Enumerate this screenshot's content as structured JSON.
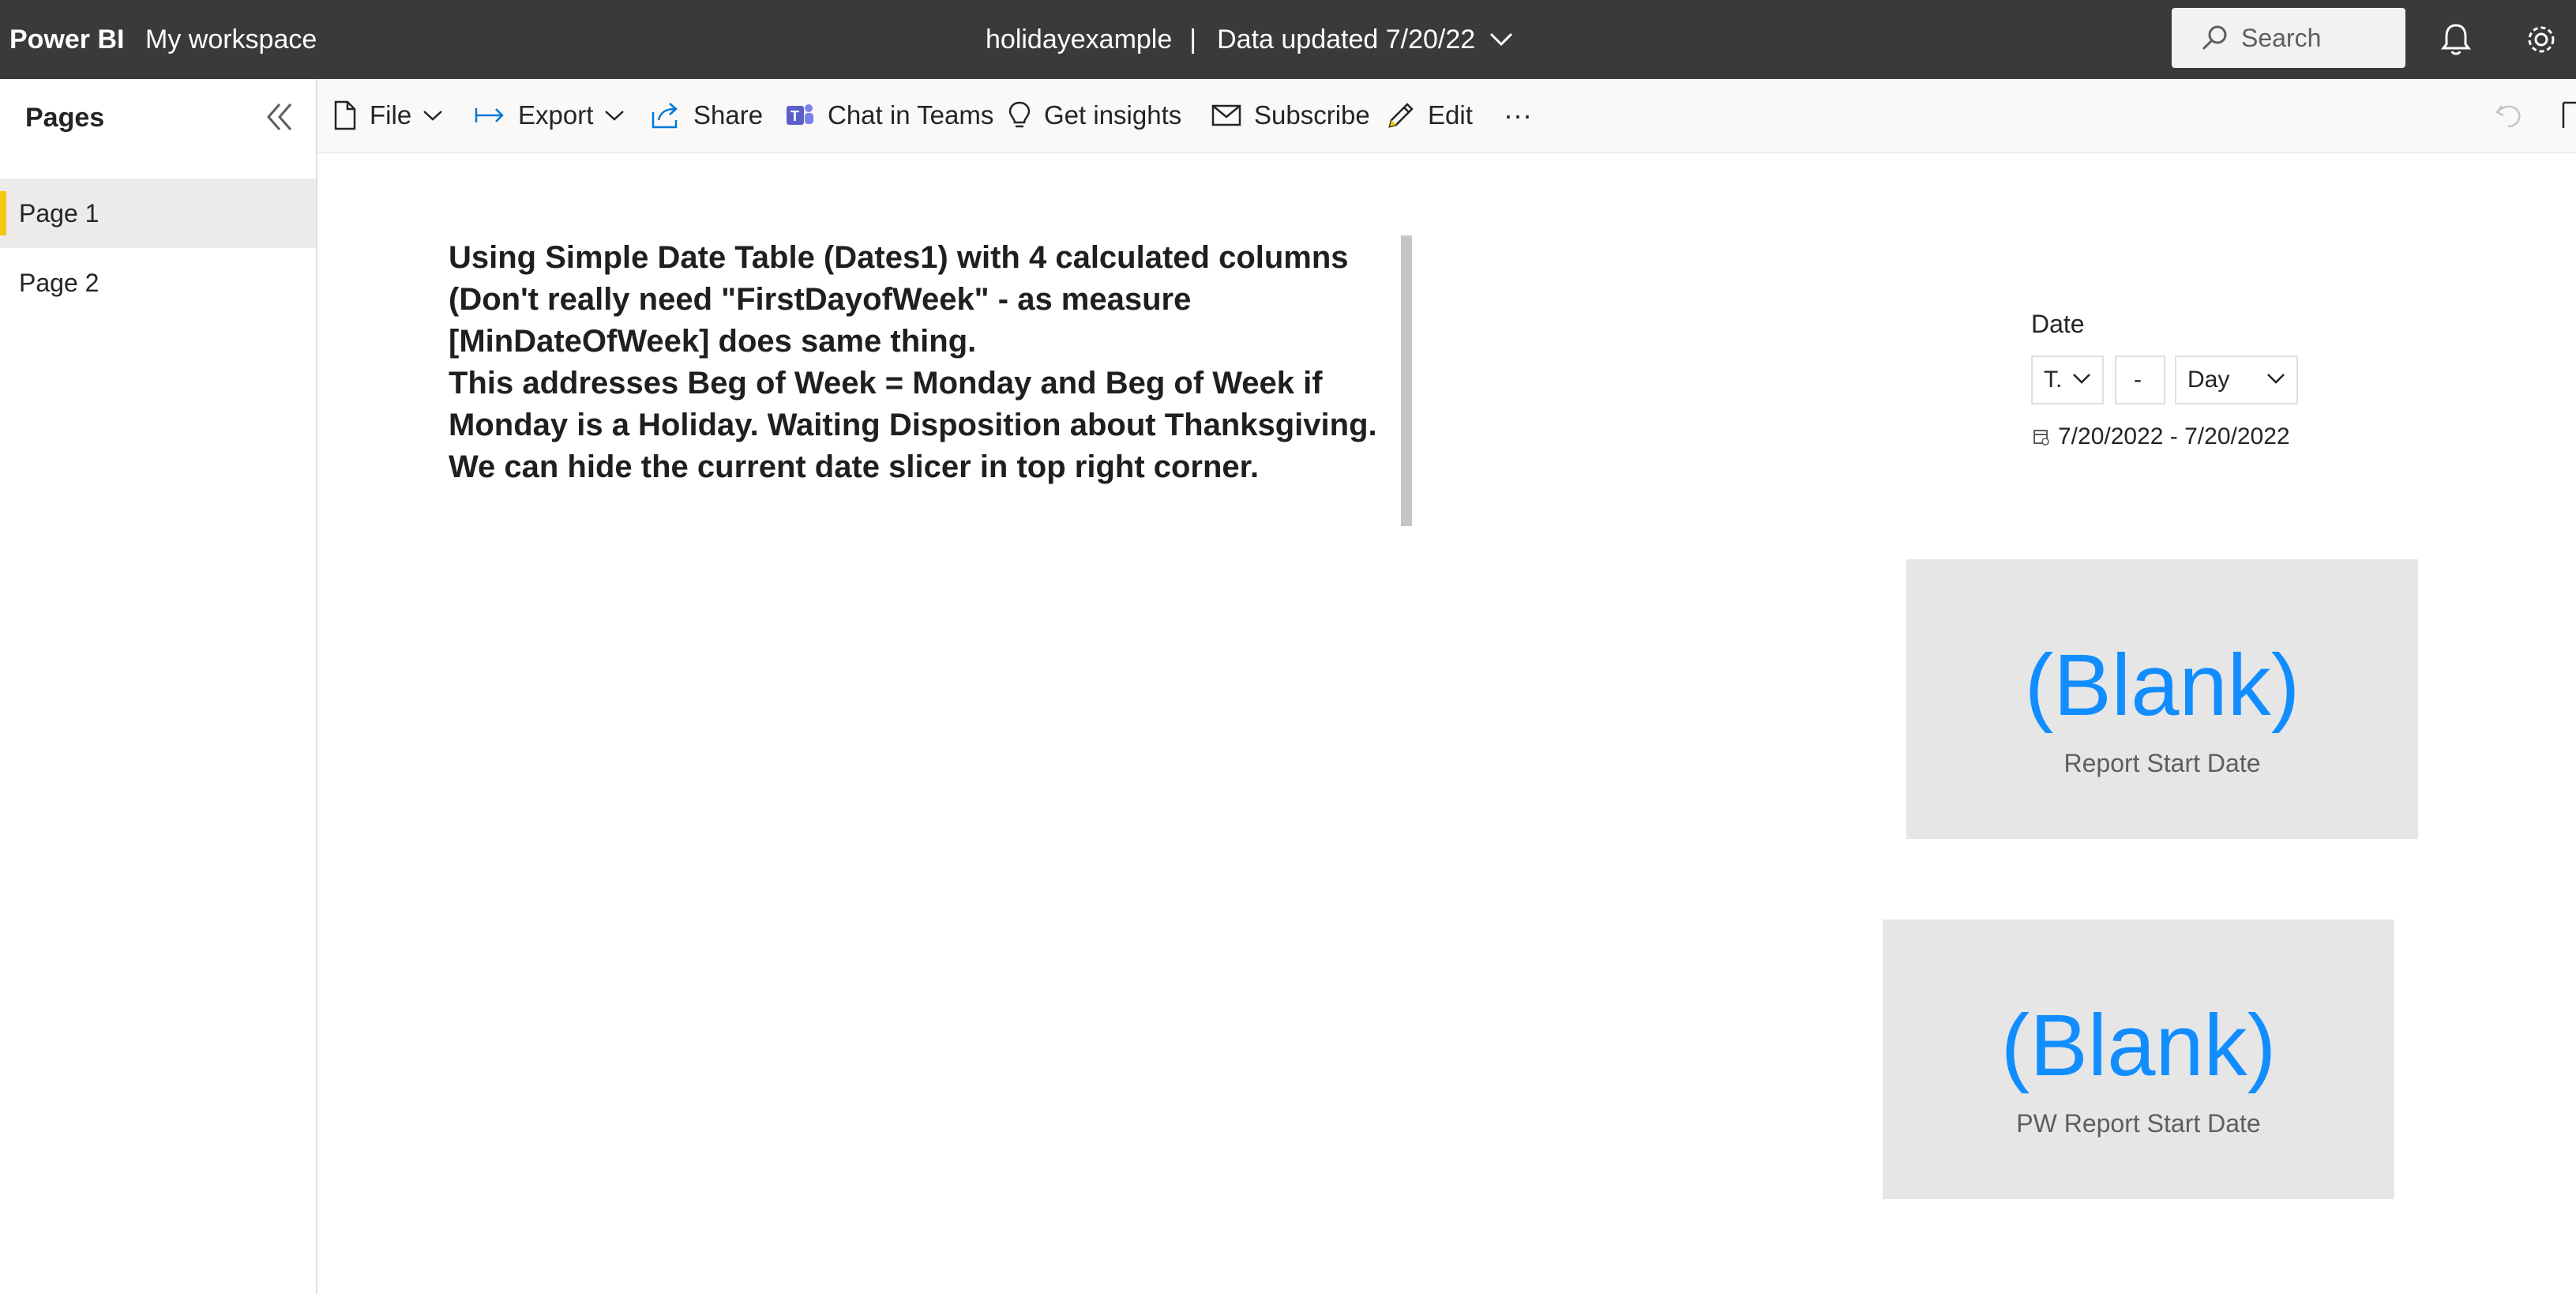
{
  "topbar": {
    "brand": "Power BI",
    "workspace": "My workspace",
    "report_name": "holidayexample",
    "separator": "|",
    "data_updated": "Data updated 7/20/22",
    "search_placeholder": "Search"
  },
  "sidebar": {
    "title": "Pages",
    "pages": [
      {
        "label": "Page 1",
        "active": true
      },
      {
        "label": "Page 2",
        "active": false
      }
    ]
  },
  "actionbar": {
    "file": "File",
    "export": "Export",
    "share": "Share",
    "chat": "Chat in Teams",
    "insights": "Get insights",
    "subscribe": "Subscribe",
    "edit": "Edit",
    "more": "···"
  },
  "textbox": {
    "line1": "Using Simple Date Table (Dates1) with 4 calculated columns (Don't really need \"FirstDayofWeek\" - as measure [MinDateOfWeek] does same thing.",
    "line2": "This addresses Beg of Week = Monday and Beg of Week if Monday is a Holiday. Waiting Disposition about Thanksgiving. We can hide the current date slicer in top right corner."
  },
  "slicer": {
    "title": "Date",
    "period": "T.",
    "count": "-",
    "unit": "Day",
    "range": "7/20/2022 - 7/20/2022"
  },
  "cards": [
    {
      "value": "(Blank)",
      "label": "Report Start Date"
    },
    {
      "value": "(Blank)",
      "label": "PW Report Start Date"
    }
  ],
  "colors": {
    "topbar": "#3b3a39",
    "accent_yellow": "#f2c811",
    "card_value": "#118dff",
    "card_bg": "#e6e6e6",
    "teams_purple": "#5b5fc7",
    "action_blue": "#0078d4"
  }
}
